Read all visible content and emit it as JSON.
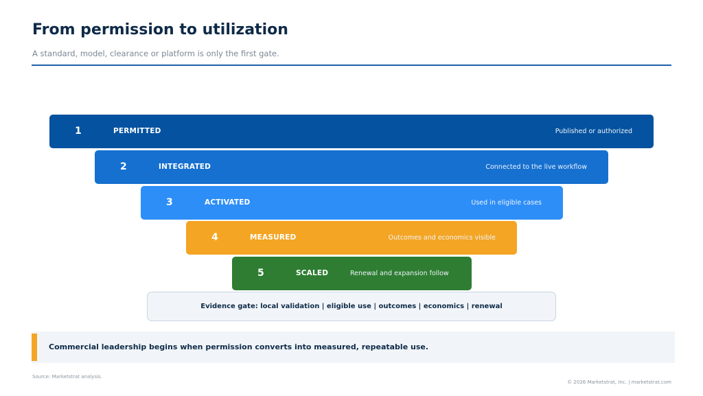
{
  "header": {
    "title": "From permission to utilization",
    "subtitle": "A standard, model, clearance or platform is only the first gate."
  },
  "funnel": {
    "stages": [
      {
        "number": "1",
        "name": "PERMITTED",
        "description": "Published or authorized",
        "color": "#0452a0"
      },
      {
        "number": "2",
        "name": "INTEGRATED",
        "description": "Connected to the live workflow",
        "color": "#1670d0"
      },
      {
        "number": "3",
        "name": "ACTIVATED",
        "description": "Used in eligible cases",
        "color": "#2e8ef8"
      },
      {
        "number": "4",
        "name": "MEASURED",
        "description": "Outcomes and economics visible",
        "color": "#f4a523"
      },
      {
        "number": "5",
        "name": "SCALED",
        "description": "Renewal and expansion follow",
        "color": "#2e7d32"
      }
    ],
    "evidence_gate": "Evidence gate: local validation | eligible use | outcomes | economics | renewal"
  },
  "callout": {
    "text": "Commercial leadership begins when permission converts into measured, repeatable use.",
    "accent_color": "#f4a523"
  },
  "footer": {
    "source": "Source: Marketstrat analysis.",
    "copyright": "© 2026 Marketstrat, Inc. | marketstrat.com"
  }
}
